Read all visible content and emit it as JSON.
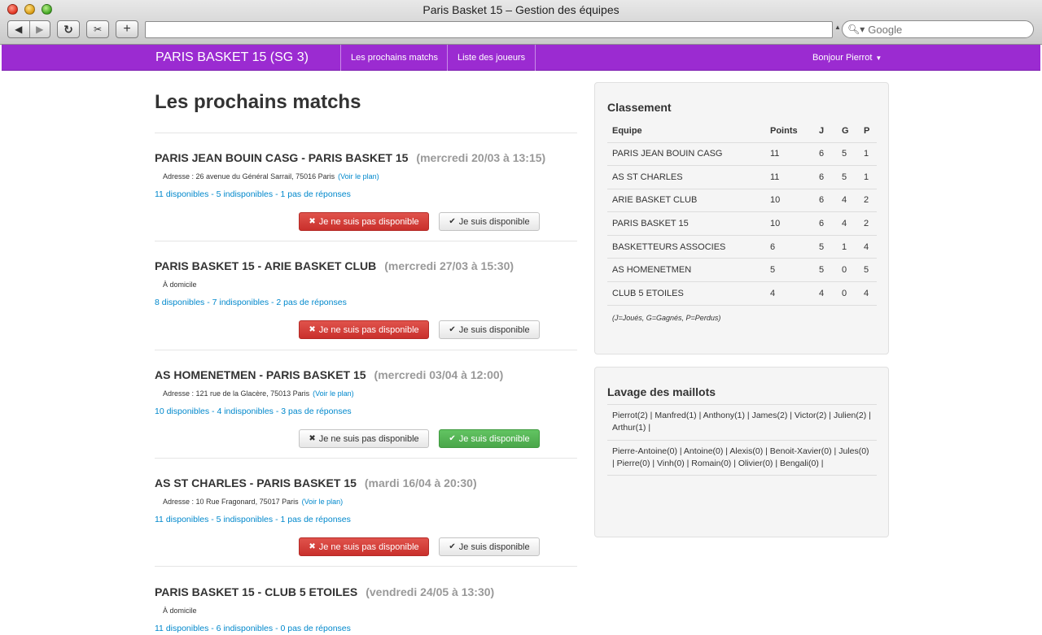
{
  "window": {
    "title": "Paris Basket 15 – Gestion des équipes",
    "url": "",
    "search_placeholder": "Google"
  },
  "toolbar": {
    "back_icon": "back-arrow-icon",
    "forward_icon": "forward-arrow-icon",
    "reload_icon": "reload-icon",
    "add_icon": "plus-icon"
  },
  "nav": {
    "brand": "PARIS BASKET 15 (SG 3)",
    "links": [
      "Les prochains matchs",
      "Liste des joueurs"
    ],
    "user_label": "Bonjour Pierrot",
    "color": "#9b2bd1"
  },
  "main": {
    "title": "Les prochains matchs",
    "unavailable_label": "Je ne suis pas disponible",
    "available_label": "Je suis disponible",
    "matches": [
      {
        "teams": "PARIS JEAN BOUIN CASG - PARIS BASKET 15",
        "date": "(mercredi 20/03 à 13:15)",
        "address": "Adresse : 26 avenue du Général Sarrail, 75016 Paris",
        "map_link": "(Voir le plan)",
        "stats": "11 disponibles - 5 indisponibles - 1 pas de réponses",
        "selected": "unavailable"
      },
      {
        "teams": "PARIS BASKET 15 - ARIE BASKET CLUB",
        "date": "(mercredi 27/03 à 15:30)",
        "address": "À domicile",
        "map_link": "",
        "stats": "8 disponibles - 7 indisponibles - 2 pas de réponses",
        "selected": "unavailable"
      },
      {
        "teams": "AS HOMENETMEN - PARIS BASKET 15",
        "date": "(mercredi 03/04 à 12:00)",
        "address": "Adresse : 121 rue de la Glacère, 75013 Paris",
        "map_link": "(Voir le plan)",
        "stats": "10 disponibles - 4 indisponibles - 3 pas de réponses",
        "selected": "available"
      },
      {
        "teams": "AS ST CHARLES - PARIS BASKET 15",
        "date": "(mardi 16/04 à 20:30)",
        "address": "Adresse : 10 Rue Fragonard, 75017 Paris",
        "map_link": "(Voir le plan)",
        "stats": "11 disponibles - 5 indisponibles - 1 pas de réponses",
        "selected": "unavailable"
      },
      {
        "teams": "PARIS BASKET 15 - CLUB 5 ETOILES",
        "date": "(vendredi 24/05 à 13:30)",
        "address": "À domicile",
        "map_link": "",
        "stats": "11 disponibles - 6 indisponibles - 0 pas de réponses",
        "selected": "none"
      }
    ]
  },
  "classement": {
    "title": "Classement",
    "headers": [
      "Equipe",
      "Points",
      "J",
      "G",
      "P"
    ],
    "rows": [
      [
        "PARIS JEAN BOUIN CASG",
        "11",
        "6",
        "5",
        "1"
      ],
      [
        "AS ST CHARLES",
        "11",
        "6",
        "5",
        "1"
      ],
      [
        "ARIE BASKET CLUB",
        "10",
        "6",
        "4",
        "2"
      ],
      [
        "PARIS BASKET 15",
        "10",
        "6",
        "4",
        "2"
      ],
      [
        "BASKETTEURS ASSOCIES",
        "6",
        "5",
        "1",
        "4"
      ],
      [
        "AS HOMENETMEN",
        "5",
        "5",
        "0",
        "5"
      ],
      [
        "CLUB 5 ETOILES",
        "4",
        "4",
        "0",
        "4"
      ]
    ],
    "legend": "(J=Joués, G=Gagnés, P=Perdus)"
  },
  "lavage": {
    "title": "Lavage des maillots",
    "rows": [
      "Pierrot(2) | Manfred(1) | Anthony(1) | James(2) | Victor(2) | Julien(2) | Arthur(1) |",
      "Pierre-Antoine(0) | Antoine(0) | Alexis(0) | Benoit-Xavier(0) | Jules(0) | Pierre(0) | Vinh(0) | Romain(0) | Olivier(0) | Bengali(0) |"
    ]
  }
}
